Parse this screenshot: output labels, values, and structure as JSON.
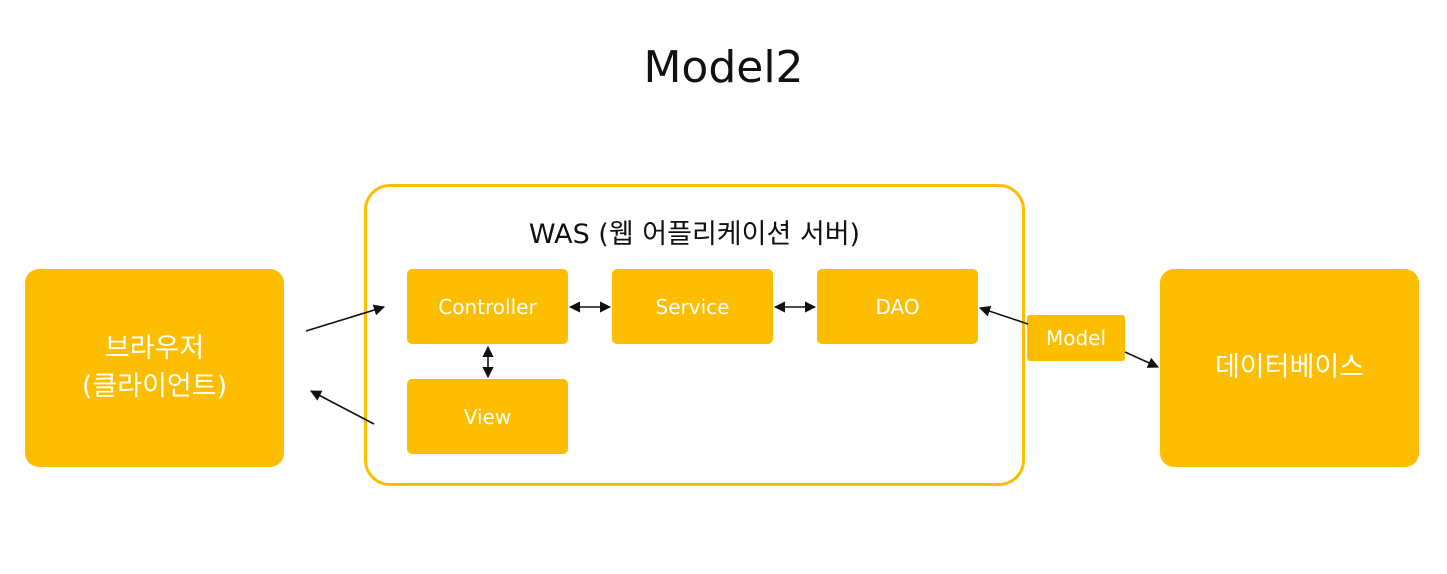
{
  "title": "Model2",
  "client": {
    "line1": "브라우저",
    "line2": "(클라이언트)"
  },
  "was": {
    "title": "WAS (웹 어플리케이션 서버)"
  },
  "components": {
    "controller": "Controller",
    "service": "Service",
    "dao": "DAO",
    "view": "View"
  },
  "model_label": "Model",
  "database": "데이터베이스",
  "colors": {
    "accent": "#FDBE00",
    "text": "#111111",
    "box_text": "#FFFFFF"
  }
}
